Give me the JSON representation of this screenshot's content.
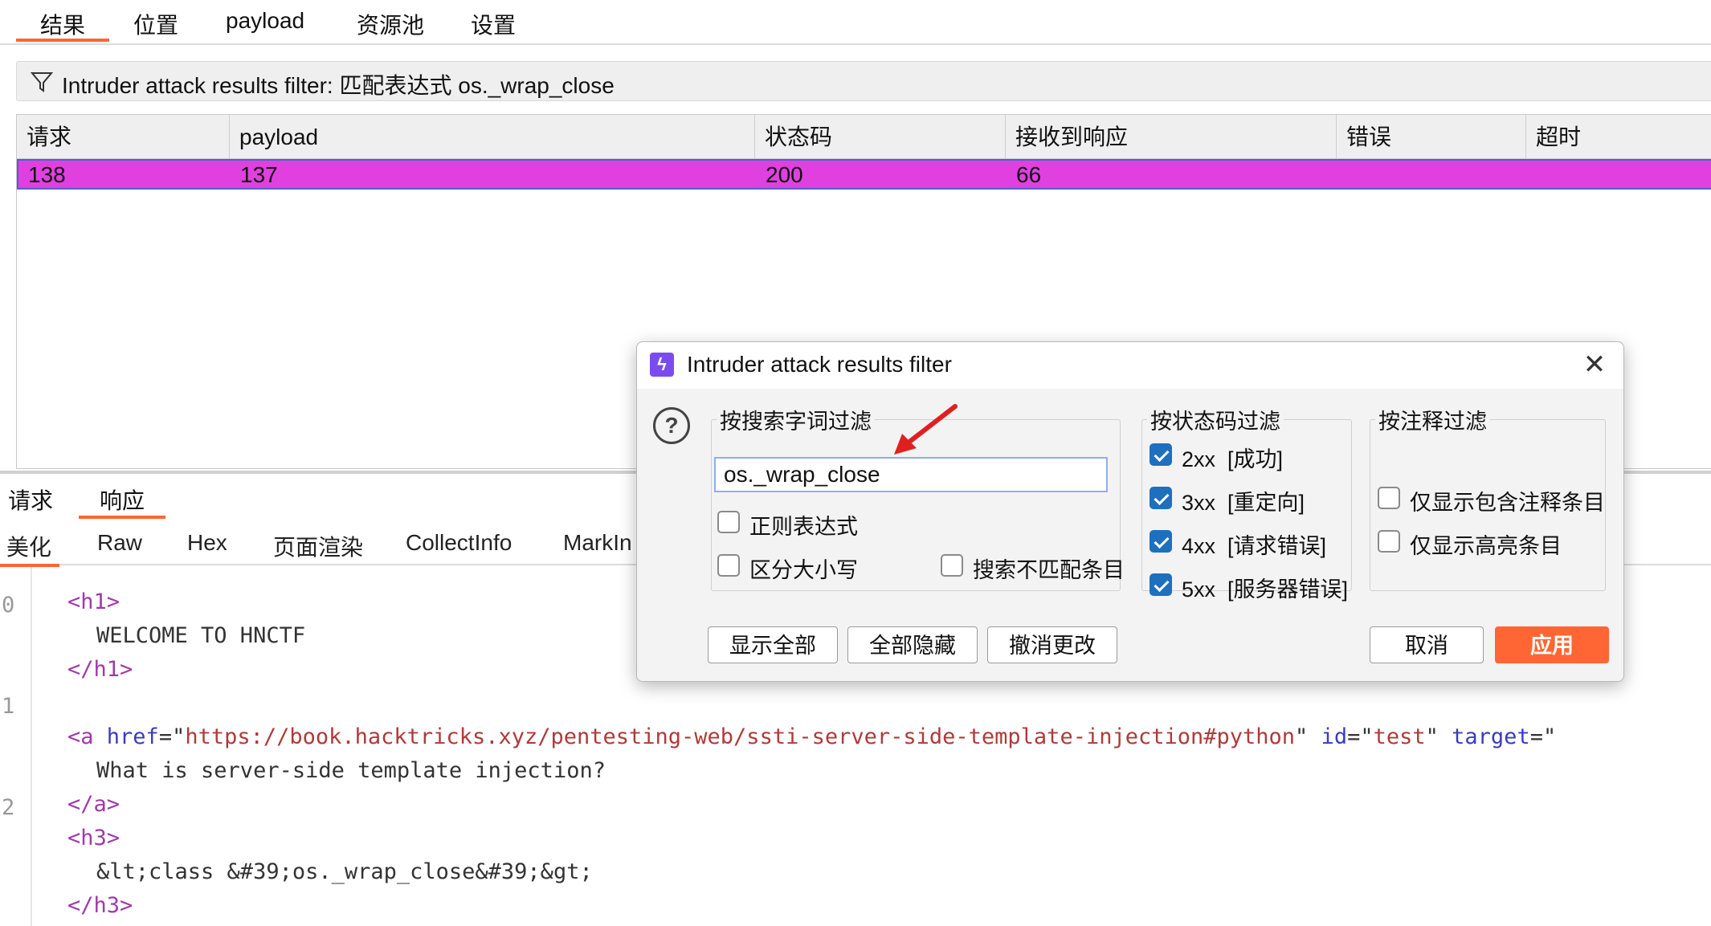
{
  "top_tabs": [
    "结果",
    "位置",
    "payload",
    "资源池",
    "设置"
  ],
  "filter_bar": {
    "text": "Intruder attack results filter: 匹配表达式 os._wrap_close"
  },
  "table": {
    "columns": [
      "请求",
      "payload",
      "状态码",
      "接收到响应",
      "错误",
      "超时"
    ],
    "rows": [
      {
        "request": "138",
        "payload": "137",
        "status": "200",
        "received": "66",
        "error": "",
        "timeout": ""
      }
    ]
  },
  "rr_tabs": [
    "请求",
    "响应"
  ],
  "view_tabs": [
    "美化",
    "Raw",
    "Hex",
    "页面渲染",
    "CollectInfo",
    "MarkIn"
  ],
  "code": {
    "line_numbers": [
      "0",
      "1",
      "2"
    ],
    "lines": {
      "h1_open": "<h1>",
      "h1_text": "WELCOME TO HNCTF",
      "h1_close": "</h1>",
      "a_lt": "<",
      "a_tag": "a",
      "a_href_attr": " href",
      "a_eq": "=\"",
      "a_href_val": "https://book.hacktricks.xyz/pentesting-web/ssti-server-side-template-injection#python",
      "a_q": "\"",
      "a_id_attr": " id",
      "a_id_eq": "=\"",
      "a_id_val": "test",
      "a_id_q": "\"",
      "a_target_attr": " target",
      "a_target_eq": "=\"",
      "a_text": "What is server-side template injection?",
      "a_close": "</a>",
      "h3_open": "<h3>",
      "h3_text": "&lt;class &#39;os._wrap_close&#39;&gt;",
      "h3_close": "</h3>"
    }
  },
  "dialog": {
    "title": "Intruder attack results filter",
    "close_glyph": "✕",
    "help_glyph": "?",
    "logo_glyph": "ϟ",
    "search_group": {
      "legend": "按搜索字词过滤",
      "value": "os._wrap_close",
      "regex": {
        "label": "正则表达式",
        "checked": false
      },
      "case": {
        "label": "区分大小写",
        "checked": false
      },
      "negative": {
        "label": "搜索不匹配条目",
        "checked": false
      }
    },
    "status_group": {
      "legend": "按状态码过滤",
      "items": [
        {
          "label": "2xx  [成功]",
          "checked": true
        },
        {
          "label": "3xx  [重定向]",
          "checked": true
        },
        {
          "label": "4xx  [请求错误]",
          "checked": true
        },
        {
          "label": "5xx  [服务器错误]",
          "checked": true
        }
      ]
    },
    "annotation_group": {
      "legend": "按注释过滤",
      "items": [
        {
          "label": "仅显示包含注释条目",
          "checked": false
        },
        {
          "label": "仅显示高亮条目",
          "checked": false
        }
      ]
    },
    "buttons": {
      "show_all": "显示全部",
      "hide_all": "全部隐藏",
      "revert": "撤消更改",
      "cancel": "取消",
      "apply": "应用"
    }
  },
  "colors": {
    "accent": "#ff6633",
    "highlight_row": "#e040e0",
    "checkbox": "#1f6fbf",
    "logo": "#7a4cf0",
    "annotation_arrow": "#e02020"
  }
}
